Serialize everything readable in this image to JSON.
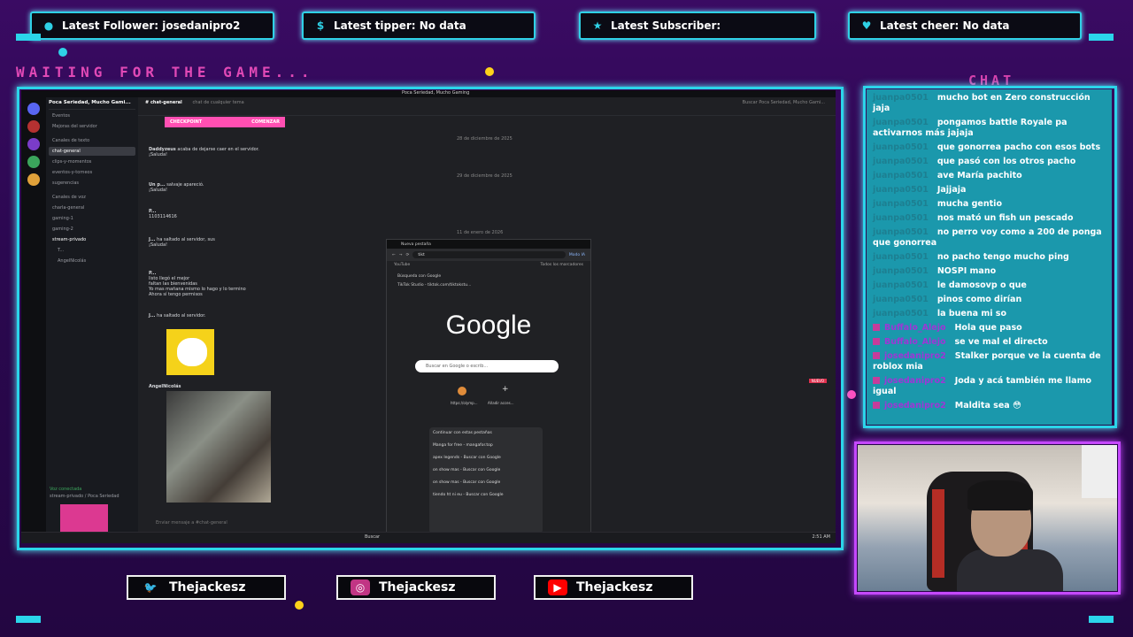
{
  "top_bars": [
    {
      "icon": "user-icon",
      "label": "Latest Follower: josedanipro2"
    },
    {
      "icon": "dollar-icon",
      "label": "Latest tipper: No data"
    },
    {
      "icon": "star-icon",
      "label": "Latest Subscriber:"
    },
    {
      "icon": "heart-icon",
      "label": "Latest cheer: No data"
    }
  ],
  "waiting_text": "WAITING FOR THE GAME...",
  "chat_title": "CHAT",
  "discord": {
    "server_name": "Poca Seriedad, Mucho Gami...",
    "channel_title": "chat-general",
    "channel_topic": "chat de cualquier tema",
    "window_title": "Poca Seriedad, Mucho Gaming",
    "search_placeholder": "Buscar Poca Seriedad, Mucho Gami...",
    "events_label": "Eventos",
    "server_improvements": "Mejoras del servidor",
    "text_channels_header": "Canales de texto",
    "voice_channels_header": "Canales de voz",
    "text_channels": [
      "chat-general",
      "clips-y-momentos",
      "eventos-y-torneos",
      "sugerencias"
    ],
    "voice_channels": [
      "charla-general",
      "gaming-1",
      "gaming-2",
      "stream-privado"
    ],
    "voice_users": [
      "T...",
      "AngelNicolás"
    ],
    "voice_status": "Voz conectada",
    "voice_status_sub": "stream-privado / Poca Seriedad",
    "checkpoint_label": "CHECKPOINT",
    "checkpoint_action": "COMENZAR",
    "date_1": "28 de diciembre de 2025",
    "date_2": "29 de diciembre de 2025",
    "date_3": "11 de enero de 2026",
    "messages": [
      {
        "author": "Daddyzeus",
        "text": "acaba de dejarse caer en el servidor.",
        "reply": "¡Saluda!"
      },
      {
        "author": "Un p...",
        "text": "salvaje apareció.",
        "reply": "¡Saluda!"
      },
      {
        "author": "P...",
        "text": "1103114616"
      },
      {
        "author": "J...",
        "text": "ha saltado al servidor, sus",
        "reply": "¡Saluda!"
      },
      {
        "author": "P...",
        "text": "listo llegó el mejor"
      },
      {
        "author": "",
        "text": "faltan las bienvenidas"
      },
      {
        "author": "",
        "text": "Yo mas mañana mismo lo hago y lo termino"
      },
      {
        "author": "",
        "text": "Ahora sí tengo permisos"
      },
      {
        "author": "J...",
        "text": "ha saltado al servidor."
      },
      {
        "author": "AngelNicolás",
        "text": ""
      }
    ],
    "message_input_placeholder": "Enviar mensaje a #chat-general",
    "new_badge": "NUEVO",
    "taskbar_search": "Buscar",
    "taskbar_time": "2:51 AM"
  },
  "chrome": {
    "tab_title": "Nueva pestaña",
    "address_value": "tikt",
    "bookmark_youtube": "YouTube",
    "all_bookmarks": "Todos los marcadores",
    "ai_mode": "Modo IA",
    "suggestion_1": "Búsqueda con Google",
    "suggestion_2": "TikTok Studio - tiktok.com/tiktokstu...",
    "google_logo": "Google",
    "search_placeholder": "Buscar en Google o escrib...",
    "shortcut_1": "https://olymp...",
    "shortcut_2": "Añadir acces...",
    "continue_tabs_header": "Continuar con estas pestañas",
    "continue_tabs": [
      "Manga for free - mangafor.top",
      "apex legends - Buscar con Google",
      "on show mas - Buscar con Google",
      "on show mas - Buscar con Google",
      "tiendo ht ni eu - Buscar con Google"
    ]
  },
  "chat": [
    {
      "user": "juanpa0501",
      "text": "mucho bot en Zero construcción jaja"
    },
    {
      "user": "juanpa0501",
      "text": "pongamos battle Royale pa activarnos más jajaja"
    },
    {
      "user": "juanpa0501",
      "text": "que gonorrea pacho con esos bots"
    },
    {
      "user": "juanpa0501",
      "text": "que pasó con los otros pacho"
    },
    {
      "user": "juanpa0501",
      "text": "ave María pachito"
    },
    {
      "user": "juanpa0501",
      "text": "Jajjaja"
    },
    {
      "user": "juanpa0501",
      "text": "mucha gentio"
    },
    {
      "user": "juanpa0501",
      "text": "nos mató un fish un pescado"
    },
    {
      "user": "juanpa0501",
      "text": "no perro voy como a 200 de ponga que gonorrea"
    },
    {
      "user": "juanpa0501",
      "text": "no pacho tengo mucho ping"
    },
    {
      "user": "juanpa0501",
      "text": "NOSPI mano"
    },
    {
      "user": "juanpa0501",
      "text": "le damosovp o que"
    },
    {
      "user": "juanpa0501",
      "text": "pinos como dirían"
    },
    {
      "user": "juanpa0501",
      "text": "la buena mi so"
    },
    {
      "user": "Buffalo_Alejo",
      "text": "Hola que paso"
    },
    {
      "user": "Buffalo_Alejo",
      "text": "se ve mal el directo"
    },
    {
      "user": "josedanipro2",
      "text": "Stalker porque ve la cuenta de roblox mia"
    },
    {
      "user": "josedanipro2",
      "text": "Joda y acá también me llamo igual"
    },
    {
      "user": "josedanipro2",
      "text": "Maldita sea 😳"
    }
  ],
  "socials": [
    {
      "icon": "twitter-icon",
      "handle": "Thejackesz",
      "color": "#1da1f2"
    },
    {
      "icon": "instagram-icon",
      "handle": "Thejackesz",
      "color": "#c13584"
    },
    {
      "icon": "youtube-icon",
      "handle": "Thejackesz",
      "color": "#ff0000"
    }
  ]
}
